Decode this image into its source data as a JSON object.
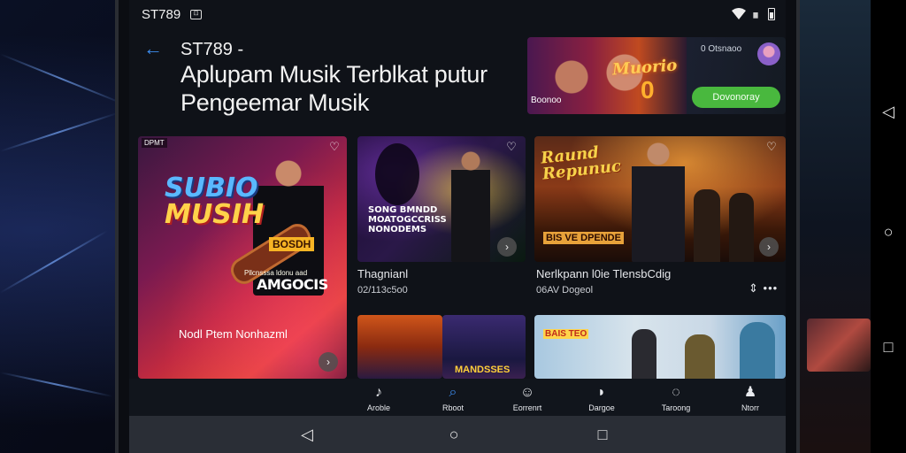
{
  "status": {
    "time": "ST789",
    "sim": "⊡"
  },
  "header": {
    "site": "ST789 -",
    "title_line1": "Aplupam Musik Terblkat putur",
    "title_line2": "Pengeemar Musik"
  },
  "promo": {
    "label": "0 Otsnaoo",
    "button": "Dovonoray",
    "art_word": "Muorio",
    "art_number": "0",
    "caption": "Boonoo"
  },
  "cards": {
    "big": {
      "badge": "DPMT",
      "title_l1": "SUBIO",
      "title_l2": "MUSIH",
      "sticker": "BOSDH",
      "sub": "Pllcnsssa ldonu aad",
      "logo": "AMGOCIS",
      "caption": "Nodl Ptem Nonhazml"
    },
    "mid": {
      "text": "SONG BMNDD\nMOATOGCCRISS\nNONODEMS",
      "title": "Thagnianl",
      "subtitle": "02/113c5o0"
    },
    "right": {
      "logo_l1": "Raund",
      "logo_l2": "Repunuc",
      "sticker": "BIS VE DPENDE",
      "title": "Nerlkpann l0ie TlensbCdig",
      "subtitle": "06AV Dogeol"
    },
    "small2": {
      "text": "MANDSSES"
    },
    "wide": {
      "text": "BAIS TEO"
    }
  },
  "tabs": [
    {
      "icon": "♪",
      "label": "Aroble"
    },
    {
      "icon": "⌕",
      "label": "Rboot"
    },
    {
      "icon": "☺",
      "label": "Eorrenrt"
    },
    {
      "icon": "◗",
      "label": "Dargoe"
    },
    {
      "icon": "◌",
      "label": "Taroong"
    },
    {
      "icon": "♟",
      "label": "Ntorr"
    }
  ],
  "colors": {
    "accent": "#3d8df0",
    "cta": "#49b83e",
    "background": "#0f1218"
  }
}
